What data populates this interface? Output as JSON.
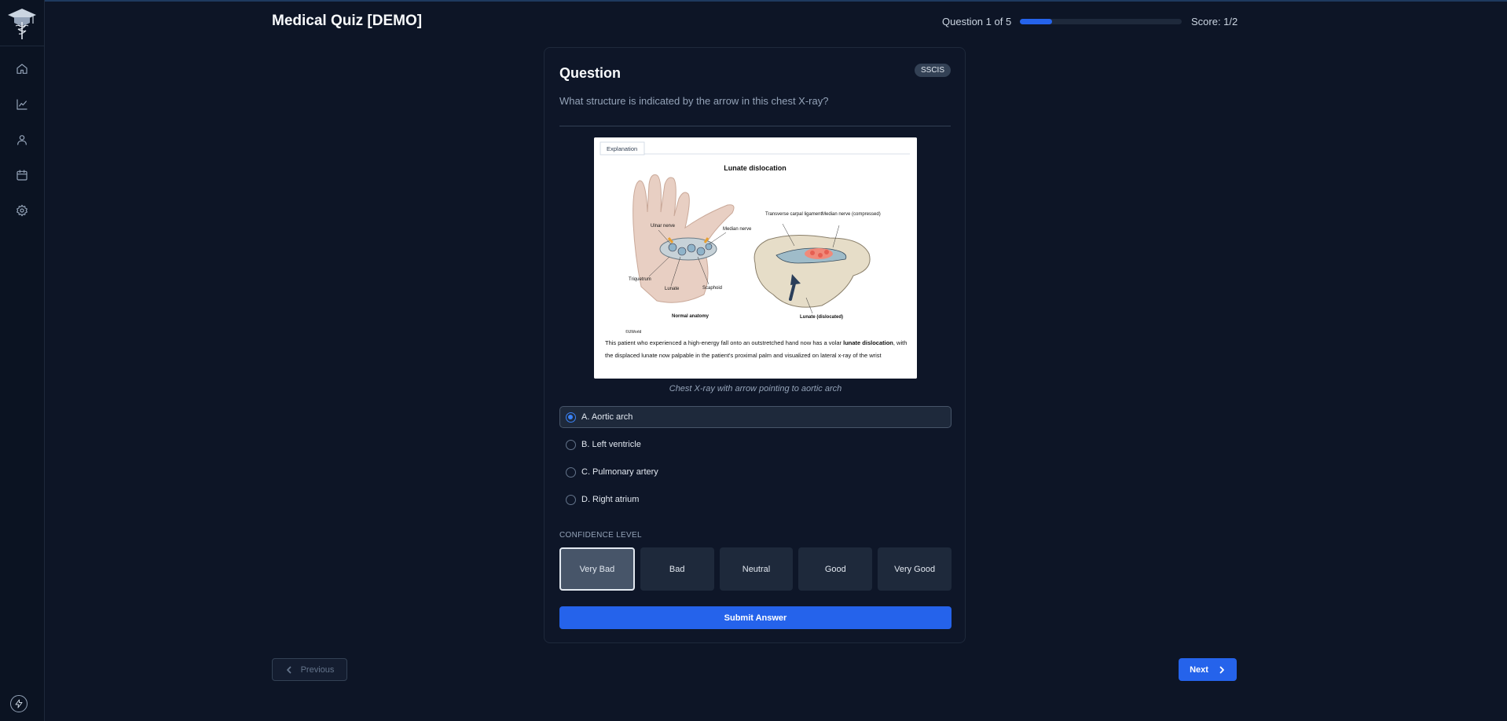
{
  "header": {
    "title": "Medical Quiz [DEMO]",
    "progress_text": "Question 1 of 5",
    "progress_fraction": 0.2,
    "score_text": "Score: 1/2"
  },
  "sidebar": {
    "icons": [
      "home-icon",
      "chart-icon",
      "user-icon",
      "calendar-icon",
      "settings-icon"
    ],
    "footer_icon": "bolt-icon"
  },
  "question": {
    "heading": "Question",
    "badge": "SSCIS",
    "text": "What structure is indicated by the arrow in this chest X-ray?",
    "caption": "Chest X-ray with arrow pointing to aortic arch"
  },
  "figure": {
    "tab": "Explanation",
    "title": "Lunate dislocation",
    "labels": {
      "ulnar_nerve": "Ulnar nerve",
      "median_nerve": "Median nerve",
      "triquetrum": "Triquetrum",
      "lunate": "Lunate",
      "scaphoid": "Scaphoid",
      "transverse": "Transverse carpal ligament",
      "median_compressed": "Median nerve (compressed)",
      "lunate_dislocated": "Lunate (dislocated)",
      "normal_anatomy": "Normal anatomy",
      "copyright": "©UWorld"
    },
    "explanation_pre": "This patient who experienced a high-energy fall onto an outstretched hand now has a volar ",
    "explanation_bold": "lunate dislocation",
    "explanation_post": ", with the displaced lunate now palpable in the patient's proximal palm and visualized on lateral x-ray of the wrist"
  },
  "options": [
    {
      "label": "A. Aortic arch",
      "selected": true
    },
    {
      "label": "B. Left ventricle",
      "selected": false
    },
    {
      "label": "C. Pulmonary artery",
      "selected": false
    },
    {
      "label": "D. Right atrium",
      "selected": false
    }
  ],
  "confidence": {
    "label": "CONFIDENCE LEVEL",
    "levels": [
      "Very Bad",
      "Bad",
      "Neutral",
      "Good",
      "Very Good"
    ],
    "selected_index": 0
  },
  "actions": {
    "submit": "Submit Answer",
    "previous": "Previous",
    "next": "Next"
  },
  "colors": {
    "background": "#0d1526",
    "accent": "#2563eb",
    "card_border": "#1e293b"
  }
}
